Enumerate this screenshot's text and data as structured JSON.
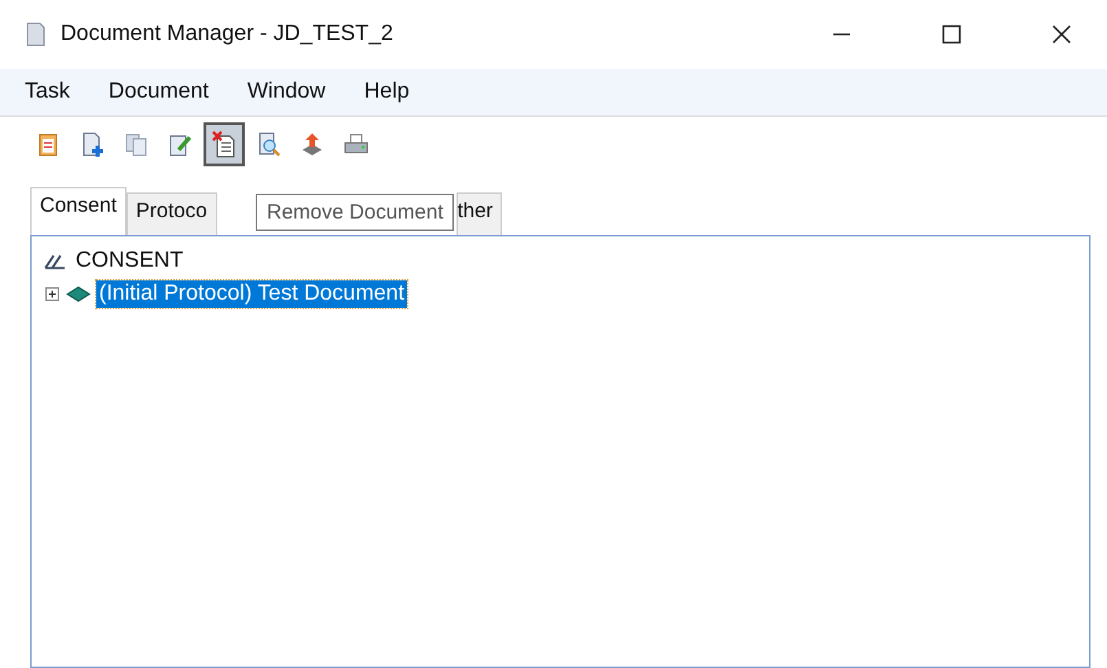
{
  "window": {
    "title": "Document Manager - JD_TEST_2"
  },
  "menu": [
    "Task",
    "Document",
    "Window",
    "Help"
  ],
  "toolbar": [
    {
      "kind": "clipboard",
      "pressed": false
    },
    {
      "kind": "add",
      "pressed": false
    },
    {
      "kind": "copy",
      "pressed": false
    },
    {
      "kind": "edit",
      "pressed": false
    },
    {
      "kind": "remove",
      "pressed": true
    },
    {
      "kind": "preview",
      "pressed": false
    },
    {
      "kind": "upload",
      "pressed": false
    },
    {
      "kind": "print",
      "pressed": false
    }
  ],
  "tabs": [
    {
      "label": "Consent",
      "selected": true
    },
    {
      "label": "Protoco",
      "selected": false
    },
    {
      "label": "ther",
      "selected": false
    }
  ],
  "tooltip": "Remove Document",
  "tree": [
    {
      "label": "CONSENT",
      "selected": false,
      "children": [
        {
          "label": "(Initial Protocol) Test Document",
          "expanded": false,
          "selected": true
        }
      ]
    }
  ]
}
